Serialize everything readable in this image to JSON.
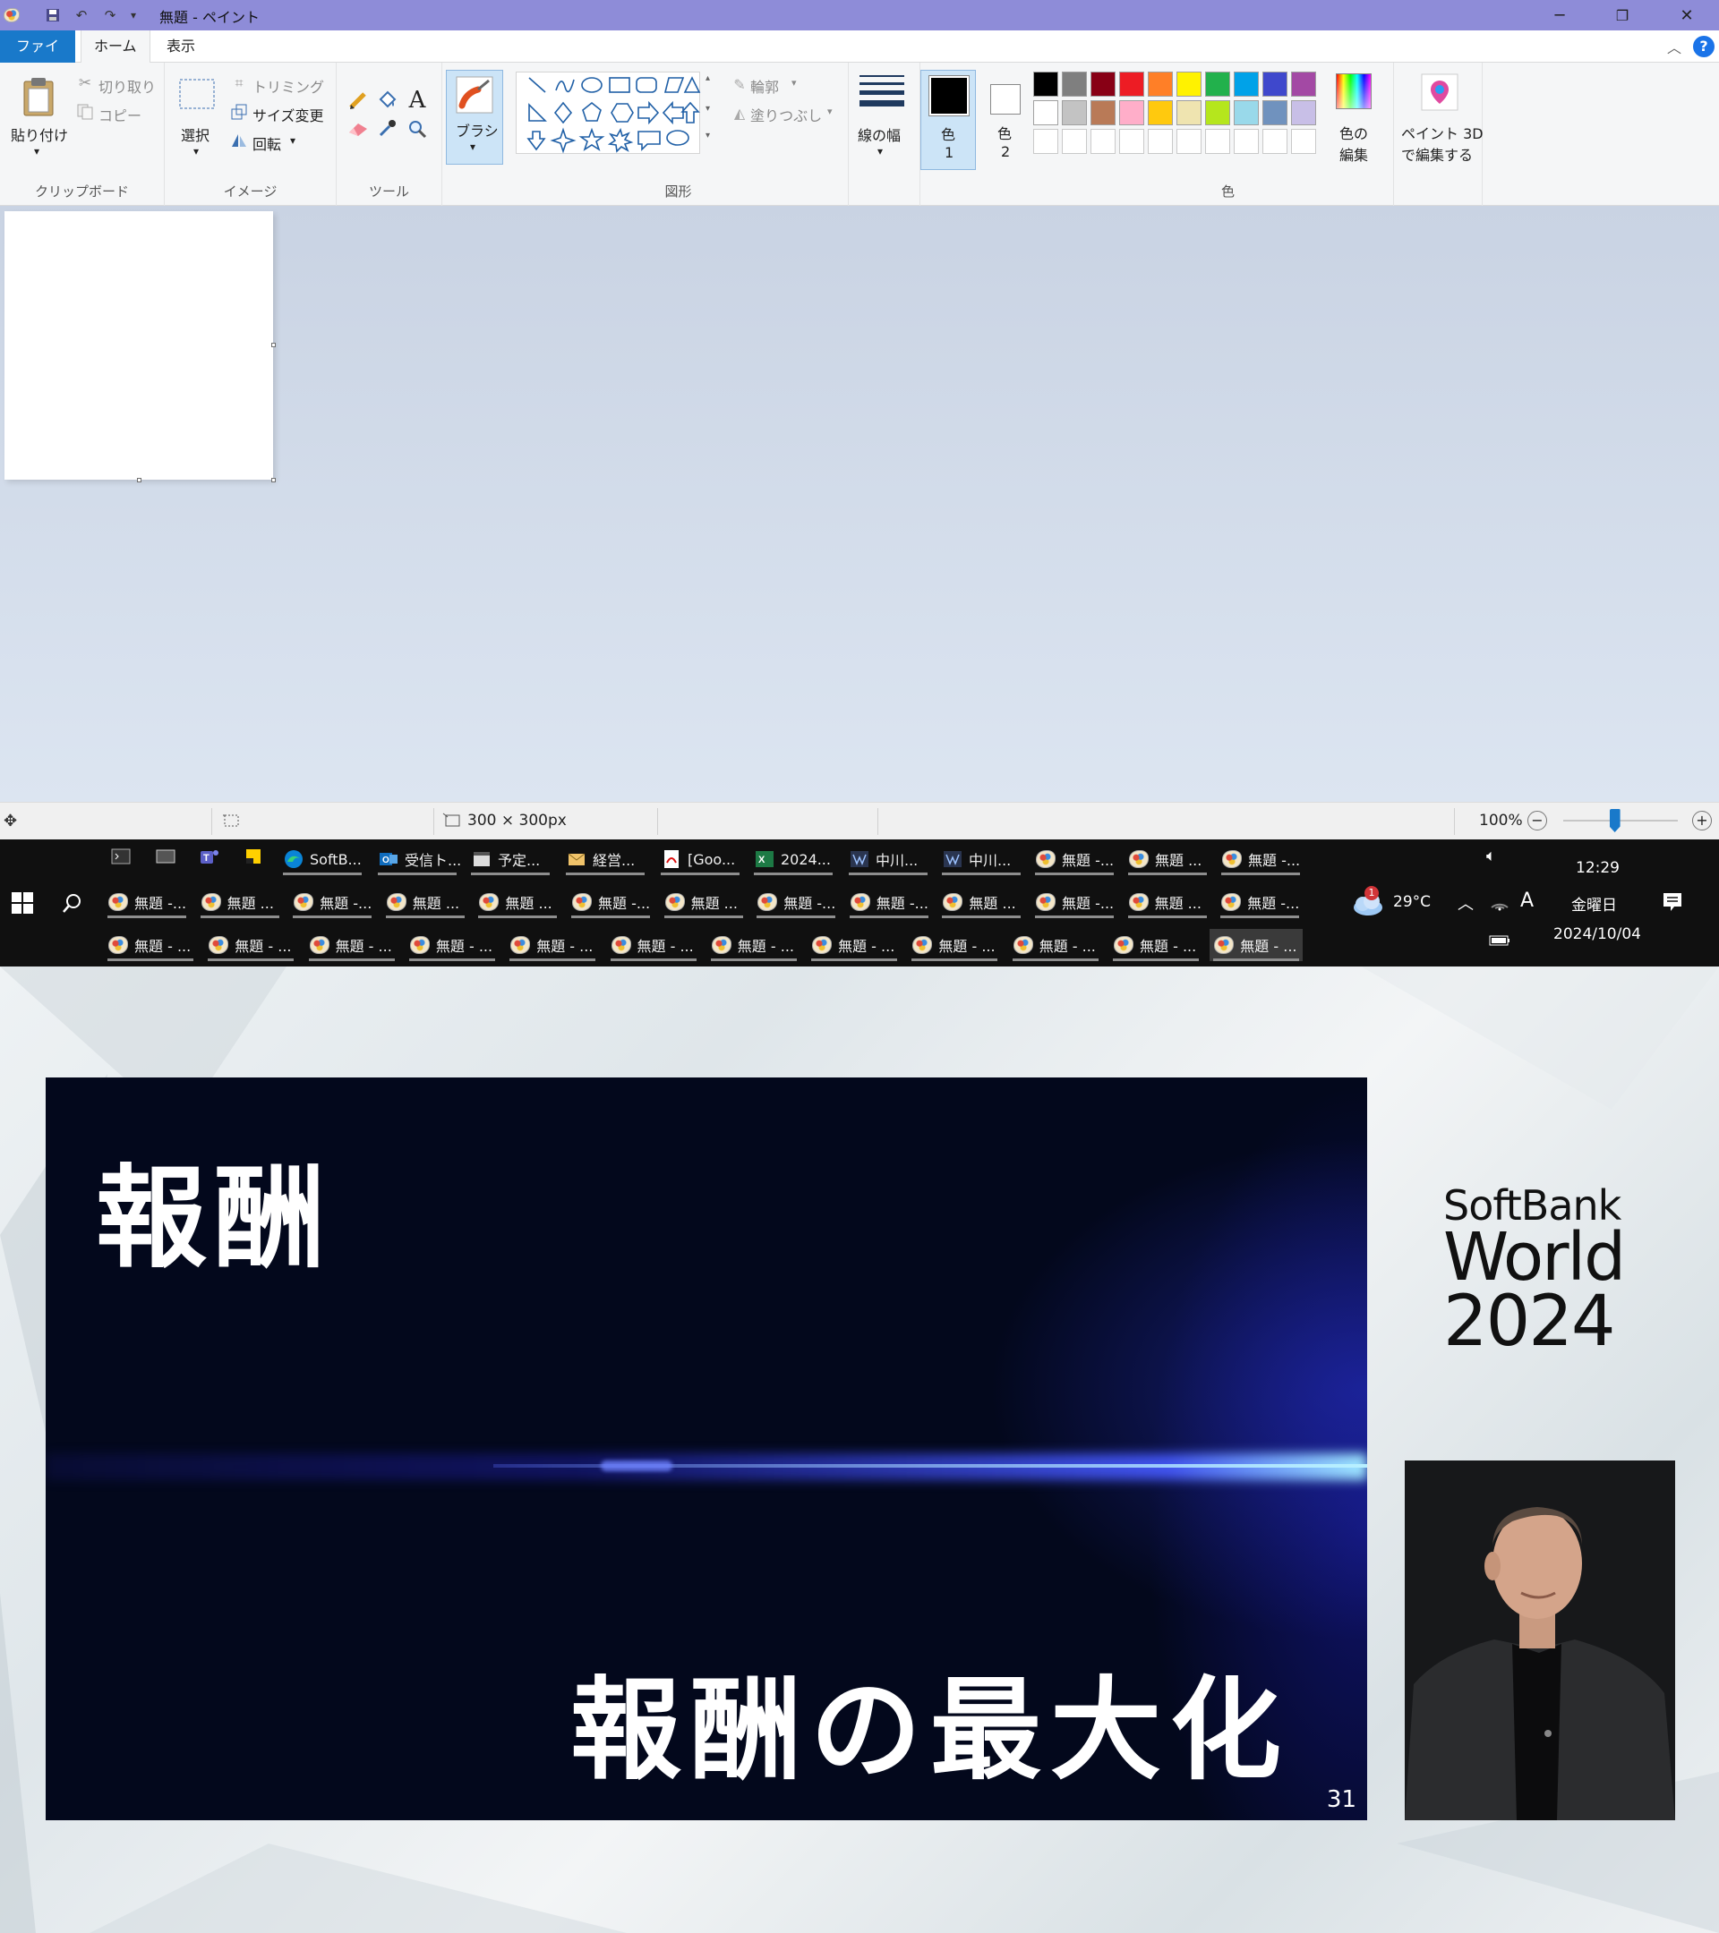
{
  "titlebar": {
    "title": "無題 - ペイント",
    "minimize": "─",
    "maximize": "❐",
    "close": "✕"
  },
  "tabs": {
    "file": "ファイル",
    "home": "ホーム",
    "view": "表示"
  },
  "ribbon": {
    "clipboard": {
      "label": "クリップボード",
      "paste": "貼り付け",
      "cut": "切り取り",
      "copy": "コピー"
    },
    "image": {
      "label": "イメージ",
      "select": "選択",
      "crop": "トリミング",
      "resize": "サイズ変更",
      "rotate": "回転"
    },
    "tools": {
      "label": "ツール"
    },
    "brush": {
      "label": "ブラシ"
    },
    "shapes": {
      "label": "図形",
      "outline": "輪郭",
      "fill": "塗りつぶし"
    },
    "size": {
      "label": "線の幅"
    },
    "colors": {
      "label": "色",
      "color1": "色",
      "color1_num": "1",
      "color2": "色",
      "color2_num": "2",
      "edit_colors_1": "色の",
      "edit_colors_2": "編集",
      "palette_row1": [
        "#000000",
        "#7f7f7f",
        "#880015",
        "#ed1c24",
        "#ff7f27",
        "#fff200",
        "#22b14c",
        "#00a2e8",
        "#3f48cc",
        "#a349a4"
      ],
      "palette_row2": [
        "#ffffff",
        "#c3c3c3",
        "#b97a57",
        "#ffaec9",
        "#ffc90e",
        "#efe4b0",
        "#b5e61d",
        "#99d9ea",
        "#7092be",
        "#c8bfe7"
      ]
    },
    "paint3d": {
      "line1": "ペイント 3D",
      "line2": "で編集する"
    }
  },
  "statusbar": {
    "image_size": "300 × 300px",
    "zoom": "100%",
    "zoom_level": 1.0
  },
  "taskbar": {
    "row1_items": [
      "SoftB...",
      "受信ト...",
      "予定...",
      "経営...",
      "[Goo...",
      "2024...",
      "中川...",
      "中川...",
      "無題 -...",
      "無題 ...",
      "無題 -..."
    ],
    "row2_items": [
      "無題 -...",
      "無題 ...",
      "無題 -...",
      "無題 ...",
      "無題 ...",
      "無題 -...",
      "無題 ...",
      "無題 -...",
      "無題 -...",
      "無題 ...",
      "無題 -...",
      "無題 ...",
      "無題 -..."
    ],
    "row3_items": [
      "無題 - ...",
      "無題 - ...",
      "無題 - ...",
      "無題 - ...",
      "無題 - ...",
      "無題 - ...",
      "無題 - ...",
      "無題 - ...",
      "無題 - ...",
      "無題 - ...",
      "無題 - ...",
      "無題 - ..."
    ],
    "weather_temp": "29°C",
    "weather_badge": "1",
    "ime": "A",
    "time": "12:29",
    "weekday": "金曜日",
    "date": "2024/10/04"
  },
  "slide": {
    "title": "報酬",
    "subtitle": "報酬の最大化",
    "page": "31"
  },
  "logo": {
    "line1": "SoftBank",
    "line2": "World",
    "line3": "2024"
  }
}
